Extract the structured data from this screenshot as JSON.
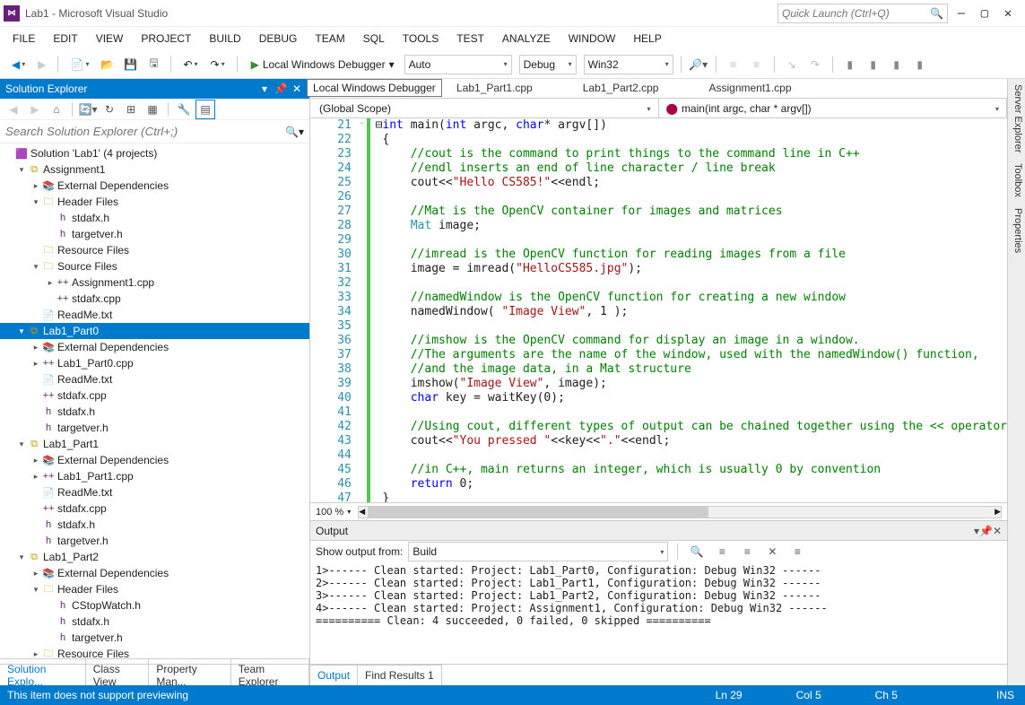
{
  "window": {
    "title": "Lab1 - Microsoft Visual Studio"
  },
  "quick_launch": {
    "placeholder": "Quick Launch (Ctrl+Q)"
  },
  "menu": [
    "FILE",
    "EDIT",
    "VIEW",
    "PROJECT",
    "BUILD",
    "DEBUG",
    "TEAM",
    "SQL",
    "TOOLS",
    "TEST",
    "ANALYZE",
    "WINDOW",
    "HELP"
  ],
  "toolbar": {
    "debugger_label": "Local Windows Debugger",
    "combo1": "Auto",
    "combo2": "Debug",
    "combo3": "Win32",
    "tooltip": "Local Windows Debugger"
  },
  "solution_explorer": {
    "title": "Solution Explorer",
    "search_placeholder": "Search Solution Explorer (Ctrl+;)",
    "tree": [
      {
        "lvl": 0,
        "exp": "",
        "icon": "sln",
        "label": "Solution 'Lab1' (4 projects)"
      },
      {
        "lvl": 1,
        "exp": "▾",
        "icon": "proj",
        "label": "Assignment1"
      },
      {
        "lvl": 2,
        "exp": "▸",
        "icon": "ref",
        "label": "External Dependencies"
      },
      {
        "lvl": 2,
        "exp": "▾",
        "icon": "fold",
        "label": "Header Files"
      },
      {
        "lvl": 3,
        "exp": "",
        "icon": "h",
        "label": "stdafx.h"
      },
      {
        "lvl": 3,
        "exp": "",
        "icon": "h",
        "label": "targetver.h"
      },
      {
        "lvl": 2,
        "exp": "",
        "icon": "fold",
        "label": "Resource Files"
      },
      {
        "lvl": 2,
        "exp": "▾",
        "icon": "fold",
        "label": "Source Files"
      },
      {
        "lvl": 3,
        "exp": "▸",
        "icon": "cpp",
        "label": "Assignment1.cpp"
      },
      {
        "lvl": 3,
        "exp": "",
        "icon": "cpp",
        "label": "stdafx.cpp"
      },
      {
        "lvl": 2,
        "exp": "",
        "icon": "txt",
        "label": "ReadMe.txt"
      },
      {
        "lvl": 1,
        "exp": "▾",
        "icon": "proj",
        "label": "Lab1_Part0",
        "selected": true
      },
      {
        "lvl": 2,
        "exp": "▸",
        "icon": "ref",
        "label": "External Dependencies"
      },
      {
        "lvl": 2,
        "exp": "▸",
        "icon": "cpp",
        "label": "Lab1_Part0.cpp"
      },
      {
        "lvl": 2,
        "exp": "",
        "icon": "txt",
        "label": "ReadMe.txt"
      },
      {
        "lvl": 2,
        "exp": "",
        "icon": "cpp",
        "label": "stdafx.cpp"
      },
      {
        "lvl": 2,
        "exp": "",
        "icon": "h",
        "label": "stdafx.h"
      },
      {
        "lvl": 2,
        "exp": "",
        "icon": "h",
        "label": "targetver.h"
      },
      {
        "lvl": 1,
        "exp": "▾",
        "icon": "proj",
        "label": "Lab1_Part1"
      },
      {
        "lvl": 2,
        "exp": "▸",
        "icon": "ref",
        "label": "External Dependencies"
      },
      {
        "lvl": 2,
        "exp": "▸",
        "icon": "cpp",
        "label": "Lab1_Part1.cpp"
      },
      {
        "lvl": 2,
        "exp": "",
        "icon": "txt",
        "label": "ReadMe.txt"
      },
      {
        "lvl": 2,
        "exp": "",
        "icon": "cpp",
        "label": "stdafx.cpp"
      },
      {
        "lvl": 2,
        "exp": "",
        "icon": "h",
        "label": "stdafx.h"
      },
      {
        "lvl": 2,
        "exp": "",
        "icon": "h",
        "label": "targetver.h"
      },
      {
        "lvl": 1,
        "exp": "▾",
        "icon": "proj",
        "label": "Lab1_Part2"
      },
      {
        "lvl": 2,
        "exp": "▸",
        "icon": "ref",
        "label": "External Dependencies"
      },
      {
        "lvl": 2,
        "exp": "▾",
        "icon": "fold",
        "label": "Header Files"
      },
      {
        "lvl": 3,
        "exp": "",
        "icon": "h",
        "label": "CStopWatch.h"
      },
      {
        "lvl": 3,
        "exp": "",
        "icon": "h",
        "label": "stdafx.h"
      },
      {
        "lvl": 3,
        "exp": "",
        "icon": "h",
        "label": "targetver.h"
      },
      {
        "lvl": 2,
        "exp": "▸",
        "icon": "fold",
        "label": "Resource Files"
      }
    ]
  },
  "editor": {
    "tabs": [
      "Lab1_Part1.cpp",
      "Lab1_Part2.cpp",
      "Assignment1.cpp"
    ],
    "scope1": "(Global Scope)",
    "scope2": "main(int argc, char * argv[])",
    "zoom": "100 %",
    "first_line": 21,
    "lines": [
      {
        "html": "⊟<span class='kw'>int</span> main(<span class='kw'>int</span> argc, <span class='kw'>char</span>* argv[])",
        "fold": "-"
      },
      {
        "html": " {",
        "fold": ""
      },
      {
        "html": "     <span class='cmt'>//cout is the command to print things to the command line in C++</span>"
      },
      {
        "html": "     <span class='cmt'>//endl inserts an end of line character / line break</span>"
      },
      {
        "html": "     cout&lt;&lt;<span class='str'>\"Hello CS585!\"</span>&lt;&lt;endl;"
      },
      {
        "html": ""
      },
      {
        "html": "     <span class='cmt'>//Mat is the OpenCV container for images and matrices</span>"
      },
      {
        "html": "     <span class='type'>Mat</span> image;"
      },
      {
        "html": ""
      },
      {
        "html": "     <span class='cmt'>//imread is the OpenCV function for reading images from a file</span>"
      },
      {
        "html": "     image = imread(<span class='str'>\"HelloCS585.jpg\"</span>);"
      },
      {
        "html": ""
      },
      {
        "html": "     <span class='cmt'>//namedWindow is the OpenCV function for creating a new window</span>"
      },
      {
        "html": "     namedWindow( <span class='str'>\"Image View\"</span>, 1 );"
      },
      {
        "html": ""
      },
      {
        "html": "     <span class='cmt'>//imshow is the OpenCV command for display an image in a window.</span>"
      },
      {
        "html": "     <span class='cmt'>//The arguments are the name of the window, used with the namedWindow() function,</span>"
      },
      {
        "html": "     <span class='cmt'>//and the image data, in a Mat structure</span>"
      },
      {
        "html": "     imshow(<span class='str'>\"Image View\"</span>, image);"
      },
      {
        "html": "     <span class='kw'>char</span> key = waitKey(0);"
      },
      {
        "html": ""
      },
      {
        "html": "     <span class='cmt'>//Using cout, different types of output can be chained together using the &lt;&lt; operator</span>"
      },
      {
        "html": "     cout&lt;&lt;<span class='str'>\"You pressed \"</span>&lt;&lt;key&lt;&lt;<span class='str'>\".\"</span>&lt;&lt;endl;"
      },
      {
        "html": ""
      },
      {
        "html": "     <span class='cmt'>//in C++, main returns an integer, which is usually 0 by convention</span>"
      },
      {
        "html": "     <span class='kw'>return</span> 0;"
      },
      {
        "html": " }"
      }
    ]
  },
  "output": {
    "title": "Output",
    "show_from_label": "Show output from:",
    "show_from_value": "Build",
    "lines": [
      "1>------ Clean started: Project: Lab1_Part0, Configuration: Debug Win32 ------",
      "2>------ Clean started: Project: Lab1_Part1, Configuration: Debug Win32 ------",
      "3>------ Clean started: Project: Lab1_Part2, Configuration: Debug Win32 ------",
      "4>------ Clean started: Project: Assignment1, Configuration: Debug Win32 ------",
      "========== Clean: 4 succeeded, 0 failed, 0 skipped =========="
    ]
  },
  "bottom_tabs_left": [
    "Solution Explo...",
    "Class View",
    "Property Man...",
    "Team Explorer"
  ],
  "bottom_tabs_right": [
    "Output",
    "Find Results 1"
  ],
  "right_rail": [
    "Server Explorer",
    "Toolbox",
    "Properties"
  ],
  "status": {
    "message": "This item does not support previewing",
    "ln": "Ln 29",
    "col": "Col 5",
    "ch": "Ch 5",
    "ins": "INS"
  }
}
